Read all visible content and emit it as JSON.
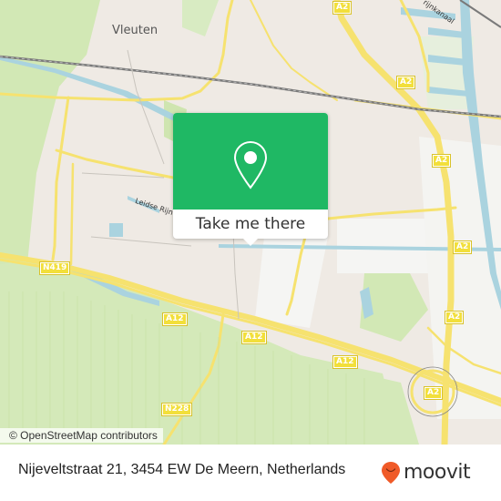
{
  "map": {
    "places": {
      "vleuten": "Vleuten"
    },
    "water_labels": {
      "leidse_rijn": "Leidse Rijn",
      "kanaal": "rijnkanaal"
    },
    "shields": {
      "a2_top": "A2",
      "a2_mid": "A2",
      "a2_right1": "A2",
      "a2_right2": "A2",
      "a2_right3": "A2",
      "a2_interchange": "A2",
      "n419": "N419",
      "a12_left": "A12",
      "a12_mid": "A12",
      "a12_right": "A12",
      "n228": "N228"
    },
    "attribution": "© OpenStreetMap contributors"
  },
  "popup": {
    "icon": "map-pin-icon",
    "button_label": "Take me there",
    "accent_color": "#1fb864"
  },
  "footer": {
    "address": "Nijeveltstraat 21, 3454 EW De Meern, Netherlands",
    "brand": "moovit",
    "brand_color": "#f05a28"
  }
}
